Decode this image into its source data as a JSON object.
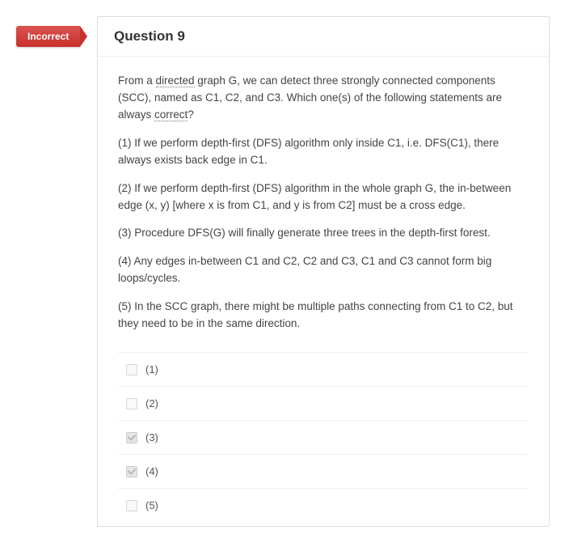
{
  "badge": "Incorrect",
  "question_title": "Question 9",
  "paragraphs": [
    {
      "html": "From a <span class='dotted'>directed</span> graph G, we can detect three strongly connected components (SCC), named as C1, C2, and C3. Which one(s) of the following statements are always <span class='dotted'>correct</span>?"
    },
    {
      "html": "(1) If we perform depth-first (DFS) algorithm only inside C1, i.e. DFS(C1), there always exists back edge in C1."
    },
    {
      "html": "(2) If we perform depth-first (DFS) algorithm in the whole graph G, the in-between edge (x, y) [where x is from C1, and y is from C2] must be a cross edge."
    },
    {
      "html": "(3) Procedure DFS(G) will finally generate three trees in the depth-first forest."
    },
    {
      "html": "(4) Any edges in-between C1 and C2, C2 and C3, C1 and C3 cannot form big loops/cycles."
    },
    {
      "html": "(5) In the SCC graph, there might be multiple paths connecting from C1 to C2, but they need to be in the same direction."
    }
  ],
  "answers": [
    {
      "label": "(1)",
      "checked": false
    },
    {
      "label": "(2)",
      "checked": false
    },
    {
      "label": "(3)",
      "checked": true
    },
    {
      "label": "(4)",
      "checked": true
    },
    {
      "label": "(5)",
      "checked": false
    }
  ]
}
